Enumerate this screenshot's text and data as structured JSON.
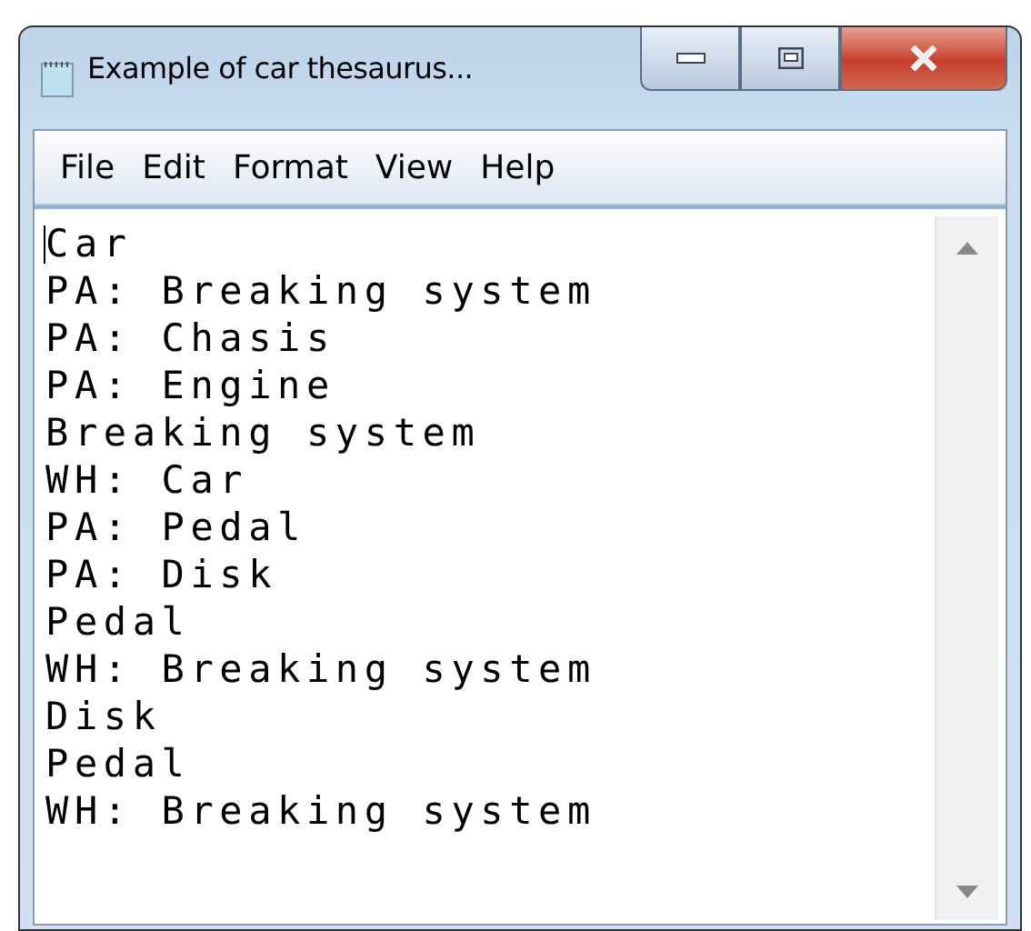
{
  "window": {
    "title": "Example of car thesaurus..."
  },
  "menu": [
    {
      "label": "File"
    },
    {
      "label": "Edit"
    },
    {
      "label": "Format"
    },
    {
      "label": "View"
    },
    {
      "label": "Help"
    }
  ],
  "editor": {
    "lines": [
      "Car",
      "PA: Breaking system",
      "PA: Chasis",
      "PA: Engine",
      "Breaking system",
      "WH: Car",
      "PA: Pedal",
      "PA: Disk",
      "Pedal",
      "WH: Breaking system",
      "Disk",
      "Pedal",
      "WH: Breaking system"
    ]
  }
}
